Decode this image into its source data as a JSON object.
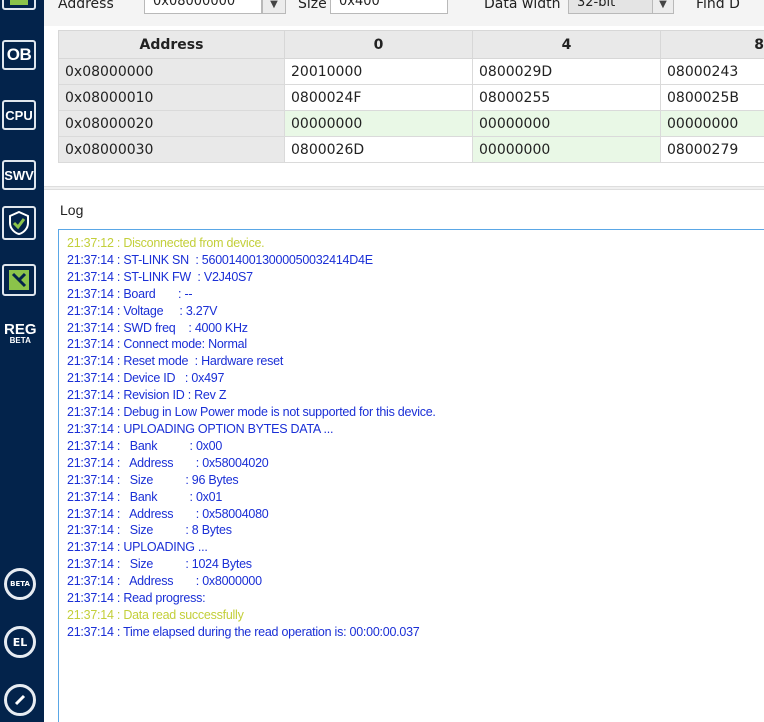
{
  "toolbar": {
    "address_label": "Address",
    "address_value": "0x08000000",
    "size_label": "Size",
    "size_value": "0x400",
    "data_width_label": "Data width",
    "data_width_value": "32-bit",
    "find_label": "Find D"
  },
  "sidebar": {
    "ob": "OB",
    "cpu": "CPU",
    "swv": "SWV",
    "reg": "REG",
    "reg_beta": "BETA",
    "beta_small": "BETA",
    "el": "EL"
  },
  "memory": {
    "headers": [
      "Address",
      "0",
      "4",
      "8"
    ],
    "rows": [
      {
        "address": "0x08000000",
        "c0": "20010000",
        "c4": "0800029D",
        "c8": "08000243"
      },
      {
        "address": "0x08000010",
        "c0": "0800024F",
        "c4": "08000255",
        "c8": "0800025B"
      },
      {
        "address": "0x08000020",
        "c0": "00000000",
        "c4": "00000000",
        "c8": "00000000"
      },
      {
        "address": "0x08000030",
        "c0": "0800026D",
        "c4": "00000000",
        "c8": "08000279"
      }
    ]
  },
  "log": {
    "title": "Log",
    "lines": [
      "21:37:12 : Disconnected from device.",
      "21:37:14 : ST-LINK SN  : 5600140013000050032414D4E",
      "21:37:14 : ST-LINK FW  : V2J40S7",
      "21:37:14 : Board       : --",
      "21:37:14 : Voltage     : 3.27V",
      "21:37:14 : SWD freq    : 4000 KHz",
      "21:37:14 : Connect mode: Normal",
      "21:37:14 : Reset mode  : Hardware reset",
      "21:37:14 : Device ID   : 0x497",
      "21:37:14 : Revision ID : Rev Z",
      "21:37:14 : Debug in Low Power mode is not supported for this device.",
      "21:37:14 : UPLOADING OPTION BYTES DATA ...",
      "21:37:14 :   Bank          : 0x00",
      "21:37:14 :   Address       : 0x58004020",
      "21:37:14 :   Size          : 96 Bytes",
      "21:37:14 :   Bank          : 0x01",
      "21:37:14 :   Address       : 0x58004080",
      "21:37:14 :   Size          : 8 Bytes",
      "21:37:14 : UPLOADING ...",
      "21:37:14 :   Size          : 1024 Bytes",
      "21:37:14 :   Address       : 0x8000000",
      "21:37:14 : Read progress:",
      "21:37:14 : Data read successfully",
      "21:37:14 : Time elapsed during the read operation is: 00:00:00.037"
    ]
  },
  "colors": {
    "sidebar_bg": "#03234b",
    "log_info": "#1a2fd6",
    "log_warn": "#c3cf3a",
    "green_cell": "#e9f8e6"
  }
}
